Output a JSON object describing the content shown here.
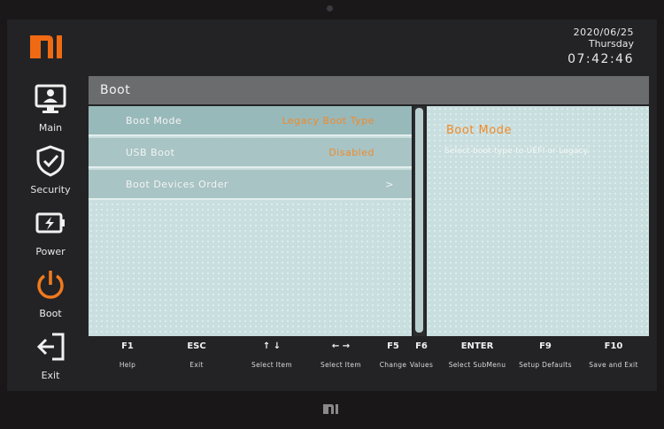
{
  "header": {
    "logo": "mi-logo",
    "date": "2020/06/25",
    "day": "Thursday",
    "time": "07:42:46"
  },
  "sidebar": {
    "items": [
      {
        "label": "Main",
        "icon": "monitor-user-icon"
      },
      {
        "label": "Security",
        "icon": "shield-check-icon"
      },
      {
        "label": "Power",
        "icon": "battery-bolt-icon"
      },
      {
        "label": "Boot",
        "icon": "power-icon",
        "active": true
      },
      {
        "label": "Exit",
        "icon": "exit-icon"
      }
    ]
  },
  "page": {
    "title": "Boot"
  },
  "settings": [
    {
      "label": "Boot Mode",
      "value": "Legacy Boot Type"
    },
    {
      "label": "USB Boot",
      "value": "Disabled"
    },
    {
      "label": "Boot Devices Order",
      "value": ">"
    }
  ],
  "help": {
    "title": "Boot Mode",
    "text": "Select boot type to UEFI or Legacy."
  },
  "footer": {
    "keys": [
      {
        "key": "F1",
        "desc": "Help"
      },
      {
        "key": "ESC",
        "desc": "Exit"
      },
      {
        "key": "↑ ↓",
        "desc": "Select Item"
      },
      {
        "key": "← →",
        "desc": "Select Item"
      },
      {
        "key": "F5",
        "desc": "Change"
      },
      {
        "key": "F6",
        "desc": "Values"
      },
      {
        "key": "ENTER",
        "desc": "Select SubMenu"
      },
      {
        "key": "F9",
        "desc": "Setup Defaults"
      },
      {
        "key": "F10",
        "desc": "Save and Exit"
      }
    ]
  },
  "colors": {
    "accent": "#f08a2a",
    "panel": "#c9dede",
    "row": "#a8c4c5",
    "titlebar": "#6a6c6d"
  }
}
